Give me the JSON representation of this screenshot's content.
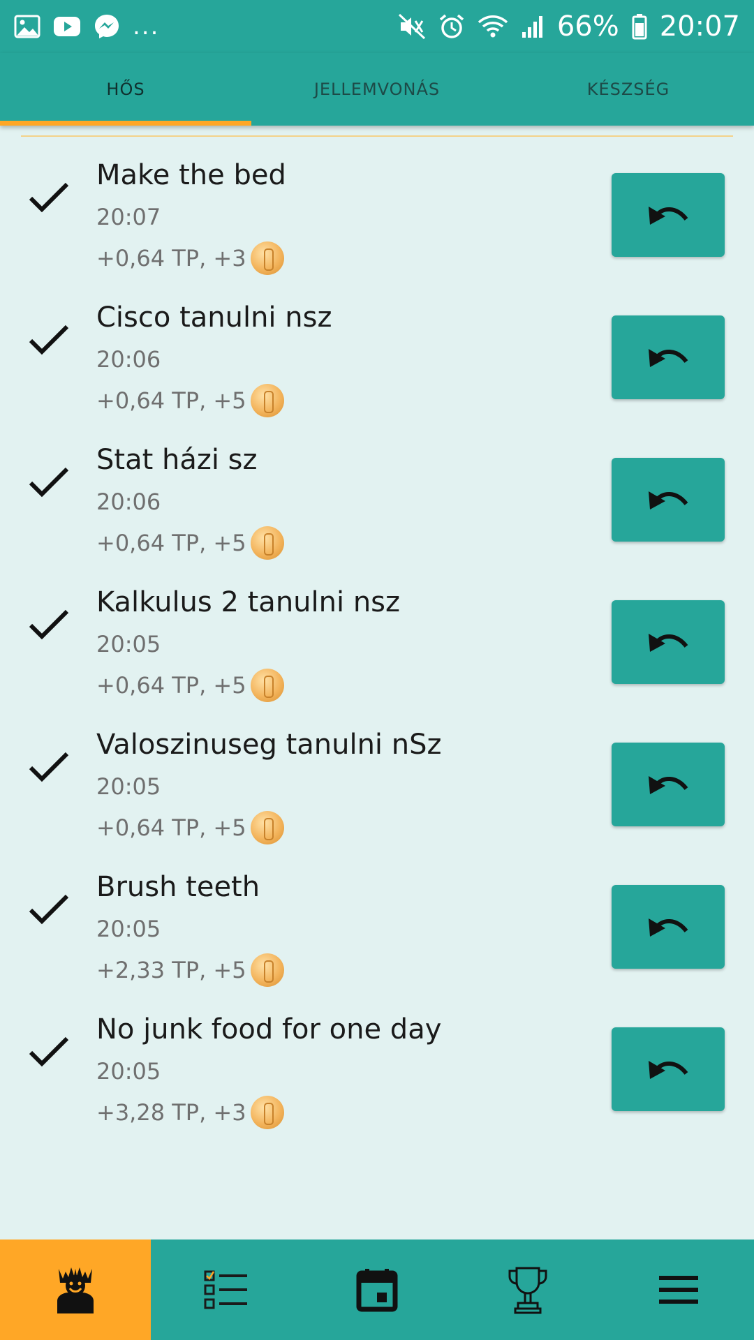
{
  "status_bar": {
    "more": "...",
    "battery_percent": "66%",
    "time": "20:07"
  },
  "tabs": [
    {
      "label": "HŐS",
      "active": true
    },
    {
      "label": "JELLEMVONÁS",
      "active": false
    },
    {
      "label": "KÉSZSÉG",
      "active": false
    }
  ],
  "tasks": [
    {
      "title": "Make the bed",
      "time": "20:07",
      "reward": "+0,64 TP, +3"
    },
    {
      "title": "Cisco tanulni nsz",
      "time": "20:06",
      "reward": "+0,64 TP, +5"
    },
    {
      "title": "Stat házi sz",
      "time": "20:06",
      "reward": "+0,64 TP, +5"
    },
    {
      "title": "Kalkulus 2 tanulni nsz",
      "time": "20:05",
      "reward": "+0,64 TP, +5"
    },
    {
      "title": "Valoszinuseg tanulni nSz",
      "time": "20:05",
      "reward": "+0,64 TP, +5"
    },
    {
      "title": "Brush teeth",
      "time": "20:05",
      "reward": "+2,33 TP, +5"
    },
    {
      "title": "No junk food for one day",
      "time": "20:05",
      "reward": "+3,28 TP, +3"
    }
  ],
  "bottom_nav": [
    {
      "icon": "hero-icon",
      "active": true
    },
    {
      "icon": "checklist-icon",
      "active": false
    },
    {
      "icon": "calendar-icon",
      "active": false
    },
    {
      "icon": "trophy-icon",
      "active": false
    },
    {
      "icon": "menu-icon",
      "active": false
    }
  ],
  "colors": {
    "primary": "#26a69a",
    "accent": "#ffa726",
    "background": "#e2f2f1"
  }
}
